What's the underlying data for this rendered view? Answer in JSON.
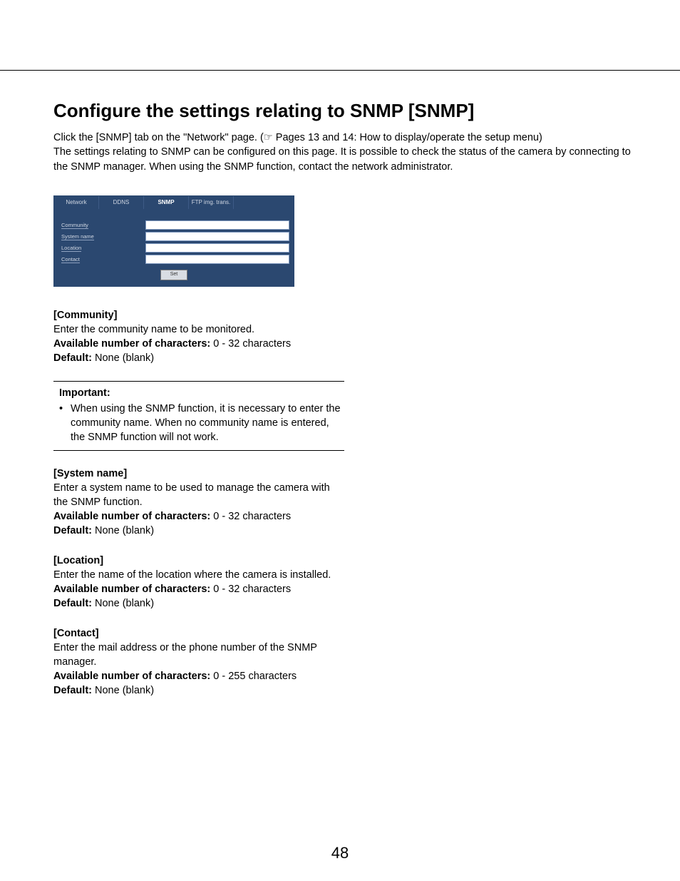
{
  "heading": "Configure the settings relating to SNMP [SNMP]",
  "intro_l1": "Click the [SNMP] tab on the \"Network\" page. (☞ Pages 13 and 14: How to display/operate the setup menu)",
  "intro_l2": "The settings relating to SNMP can be configured on this page. It is possible to check the status of the camera by connecting to the SNMP manager. When using the SNMP function, contact the network administrator.",
  "shot": {
    "tabs": [
      "Network",
      "DDNS",
      "SNMP",
      "FTP img. trans."
    ],
    "active_tab_index": 2,
    "fields": [
      "Community",
      "System name",
      "Location",
      "Contact"
    ],
    "set_btn": "Set"
  },
  "sections": {
    "community": {
      "title": "[Community]",
      "desc": "Enter the community name to be monitored.",
      "chars_label": "Available number of characters:",
      "chars_value": " 0 - 32 characters",
      "default_label": "Default:",
      "default_value": " None (blank)"
    },
    "important": {
      "label": "Important:",
      "bullet": "When using the SNMP function, it is necessary to enter the community name. When no community name is entered, the SNMP function will not work."
    },
    "system_name": {
      "title": "[System name]",
      "desc": "Enter a system name to be used to manage the camera with the SNMP function.",
      "chars_label": "Available number of characters:",
      "chars_value": " 0 - 32 characters",
      "default_label": "Default:",
      "default_value": " None (blank)"
    },
    "location": {
      "title": "[Location]",
      "desc": "Enter the name of the location where the camera is installed.",
      "chars_label": "Available number of characters:",
      "chars_value": " 0 - 32 characters",
      "default_label": "Default:",
      "default_value": " None (blank)"
    },
    "contact": {
      "title": "[Contact]",
      "desc": "Enter the mail address or the phone number of the SNMP manager.",
      "chars_label": "Available number of characters:",
      "chars_value": " 0 - 255 characters",
      "default_label": "Default:",
      "default_value": " None (blank)"
    }
  },
  "page_number": "48"
}
